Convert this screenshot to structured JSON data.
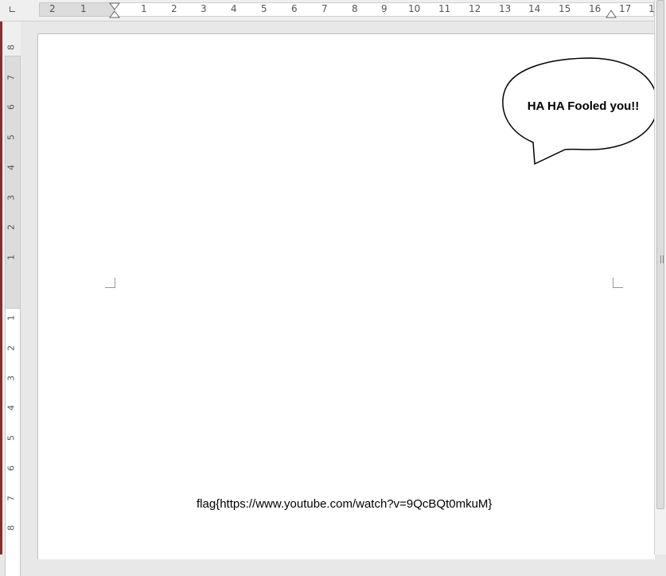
{
  "ruler": {
    "h_labels": [
      "2",
      "1",
      "1",
      "2",
      "3",
      "4",
      "5",
      "6",
      "7",
      "8",
      "9",
      "10",
      "11",
      "12",
      "13",
      "14",
      "15",
      "16",
      "17",
      "1"
    ],
    "v_labels": [
      "8",
      "7",
      "6",
      "5",
      "4",
      "3",
      "2",
      "1",
      "1",
      "2",
      "3",
      "4",
      "5",
      "6",
      "7",
      "8"
    ]
  },
  "document": {
    "callout_text": "HA HA Fooled you!!",
    "body_text": "flag{https://www.youtube.com/watch?v=9QcBQt0mkuM}"
  },
  "icons": [
    "tab-stop-icon",
    "indent-marker-icon",
    "scroll-grip-icon"
  ]
}
